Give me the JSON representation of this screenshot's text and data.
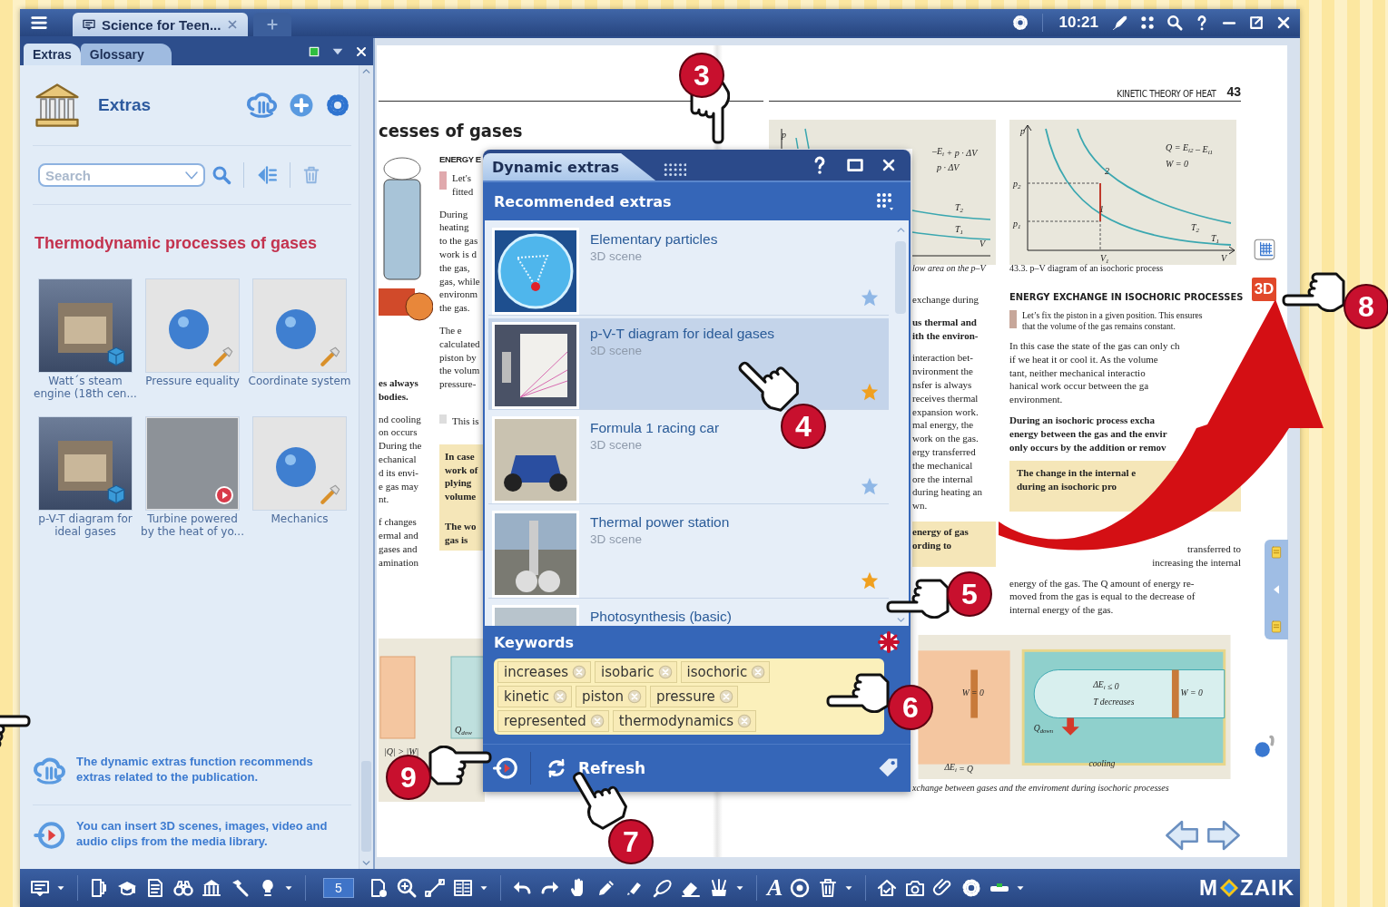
{
  "window": {
    "tabs": [
      {
        "label": "Science for Teen...",
        "selected": true
      }
    ],
    "time": "10:21"
  },
  "extras_panel": {
    "tabs": [
      {
        "label": "Extras",
        "selected": true
      },
      {
        "label": "Glossary",
        "selected": false
      }
    ],
    "title": "Extras",
    "search": {
      "placeholder": "Search"
    },
    "heading": "Thermodynamic processes of gases",
    "items": [
      {
        "caption": "Watt´s steam engine (18th cen...",
        "kind": "scene"
      },
      {
        "caption": "Pressure equality",
        "kind": "tool"
      },
      {
        "caption": "Coordinate system",
        "kind": "tool"
      },
      {
        "caption": "p-V-T diagram for ideal gases",
        "kind": "scene"
      },
      {
        "caption": "Turbine powered by the heat of yo...",
        "kind": "video"
      },
      {
        "caption": "Mechanics",
        "kind": "tool"
      }
    ],
    "tips": [
      "The dynamic extras function recommends extras related to the publication.",
      "You can insert 3D scenes, images, video and audio clips from the media library."
    ]
  },
  "book": {
    "left_page": {
      "title": "cesses of gases",
      "section": "ENERGY E",
      "col_a": [
        "es always\nbodies.",
        "nd cooling\non occurs\nDuring the\nechanical\nd its envi-\ne gas may\nnt.",
        "f changes\nermal and\ngases and\namination"
      ],
      "col_b": [
        "Let's\nfitted",
        "During\nheating\nto the gas\nwork is d\nthe gas,\ngas, while\nenvironm\nthe gas.",
        "The e\ncalculated\npiston by\nthe volum\npressure-",
        "This is"
      ],
      "note_box": [
        "In case\nwork of\nplying\nvolume",
        "The wo\ngas is"
      ],
      "figure_labels": [
        "|Q| > |W|",
        "Q$_{dow}$"
      ]
    },
    "right_page": {
      "running_head": "KINETIC THEORY OF HEAT",
      "page_number": "43",
      "figure_a_labels": [
        "p",
        "–E$_{i}$ + p · ΔV",
        "p · ΔV",
        "T$_{2}$",
        "T$_{1}$",
        "V"
      ],
      "figure_b_labels": [
        "p",
        "p$_{2}$",
        "p$_{1}$",
        "2",
        "1",
        "Q = E$_{i2}$ – E$_{i1}$",
        "W = 0",
        "T$_{2}$",
        "T$_{1}$",
        "V$_{1}$",
        "V"
      ],
      "caption_a": "low area on the p–V",
      "caption_b": "43.3. p–V diagram of an isochoric process",
      "col_c": [
        "exchange during",
        "us thermal and\nith the environ-",
        "interaction bet-\nnvironment the\nnsfer is always\nreceives thermal\nexpansion work.\nmal energy, the\nwork on the gas.\nergy transferred\nthe mechanical\nore the internal\nduring heating an\nwn."
      ],
      "col_c_box": "energy of gas\nording to",
      "heading": "ENERGY EXCHANGE IN ISOCHORIC PROCESSES",
      "paragraphs": [
        "Let’s fix the piston in a given position. This ensures\nthat the volume of the gas remains constant.",
        "In this case the state of the gas can only ch\nif we heat it or cool it. As the volume\ntant, neither mechanical interactio\nhanical work occur between the ga\nenvironment.",
        "During an isochoric process excha\nenergy between the gas and the envir\nonly occurs by the addition or remov"
      ],
      "box": "The change in the internal e\nduring an isochoric pro",
      "fragment": "transferred to\nincreasing the internal",
      "closing": "energy of the gas. The Q amount of energy re-\nmoved from the gas is equal to the decrease of\ninternal energy of the gas.",
      "figure_c_labels": [
        "W = 0",
        "ΔE$_{i}$ ≤ 0",
        "T decreases",
        "W = 0",
        "Q$_{down}$",
        "ΔE$_{i}$ = Q",
        "cooling"
      ],
      "caption_c": "xchange between gases and the enviroment during isochoric processes",
      "badge": "3D"
    }
  },
  "dynamic_extras": {
    "title": "Dynamic extras",
    "header": "Recommended extras",
    "items": [
      {
        "title": "Elementary particles",
        "subtitle": "3D scene",
        "starred": false,
        "selected": false
      },
      {
        "title": "p-V-T diagram for ideal gases",
        "subtitle": "3D scene",
        "starred": true,
        "selected": true
      },
      {
        "title": "Formula 1 racing car",
        "subtitle": "3D scene",
        "starred": false,
        "selected": false
      },
      {
        "title": "Thermal power station",
        "subtitle": "3D scene",
        "starred": true,
        "selected": false
      },
      {
        "title": "Photosynthesis (basic)",
        "selected": false
      }
    ],
    "keywords_title": "Keywords",
    "keywords": [
      "increases",
      "isobaric",
      "isochoric",
      "kinetic",
      "piston",
      "pressure",
      "represented",
      "thermodynamics"
    ],
    "refresh": "Refresh"
  },
  "toolbar": {
    "text_tool": "A",
    "page": "5",
    "logo_left": "M",
    "logo_right": "ZAIK"
  },
  "callouts": [
    {
      "number": "3"
    },
    {
      "number": "4"
    },
    {
      "number": "5"
    },
    {
      "number": "6"
    },
    {
      "number": "7"
    },
    {
      "number": "8"
    },
    {
      "number": "9"
    }
  ]
}
